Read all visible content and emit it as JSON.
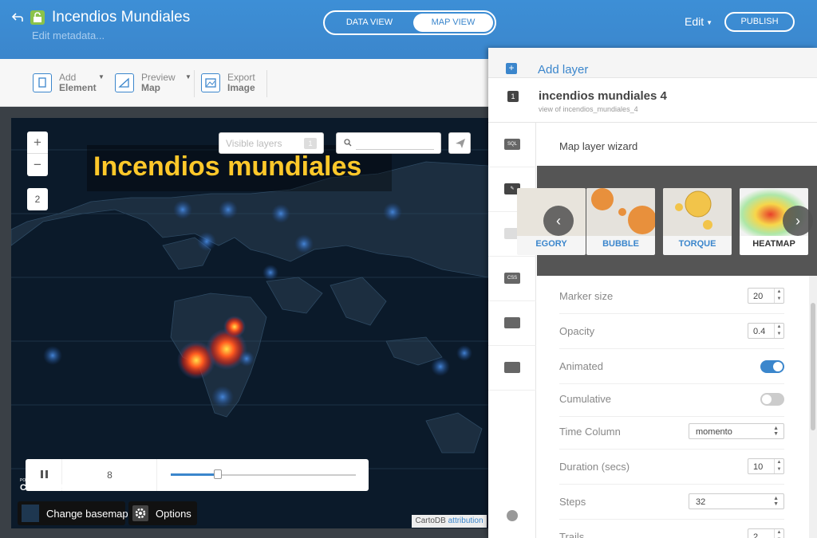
{
  "header": {
    "title": "Incendios Mundiales",
    "edit_metadata": "Edit metadata...",
    "tabs": [
      "DATA VIEW",
      "MAP VIEW"
    ],
    "edit_menu": "Edit",
    "publish": "PUBLISH"
  },
  "toolbar": {
    "add": {
      "line1": "Add",
      "line2": "Element"
    },
    "preview": {
      "line1": "Preview",
      "line2": "Map"
    },
    "export": {
      "line1": "Export",
      "line2": "Image"
    }
  },
  "map": {
    "title": "Incendios mundiales",
    "zoom_in": "+",
    "zoom_out": "−",
    "zoom_level": "2",
    "visible_layers_placeholder": "Visible layers",
    "visible_layers_count": "1",
    "player_step": "8",
    "powered_by": "POWERED BY",
    "powered_brand": "CARTODB",
    "change_basemap": "Change basemap",
    "options": "Options",
    "attribution_prefix": "CartoDB",
    "attribution_link": "attribution",
    "player_progress": 0.25
  },
  "panel": {
    "add_layer": "Add layer",
    "layer_number": "1",
    "layer_name": "incendios mundiales 4",
    "layer_sub": "view of incendios_mundiales_4",
    "wizard_title": "Map layer wizard",
    "side_tabs": [
      "SQL",
      "wizard",
      "infowindow",
      "CSS",
      "legend",
      "filters",
      "layer-options"
    ],
    "cards": [
      "EGORY",
      "BUBBLE",
      "TORQUE",
      "HEATMAP"
    ],
    "properties": {
      "marker_size": {
        "label": "Marker size",
        "value": "20"
      },
      "opacity": {
        "label": "Opacity",
        "value": "0.4"
      },
      "animated": {
        "label": "Animated",
        "on": true
      },
      "cumulative": {
        "label": "Cumulative",
        "on": false
      },
      "time_column": {
        "label": "Time Column",
        "value": "momento"
      },
      "duration": {
        "label": "Duration (secs)",
        "value": "10"
      },
      "steps": {
        "label": "Steps",
        "value": "32"
      },
      "trails": {
        "label": "Trails",
        "value": "2"
      }
    }
  },
  "colors": {
    "accent": "#3b86cc",
    "header": "#3d8fd6",
    "map_bg": "#0b1a2a",
    "title_yellow": "#fec82a"
  }
}
